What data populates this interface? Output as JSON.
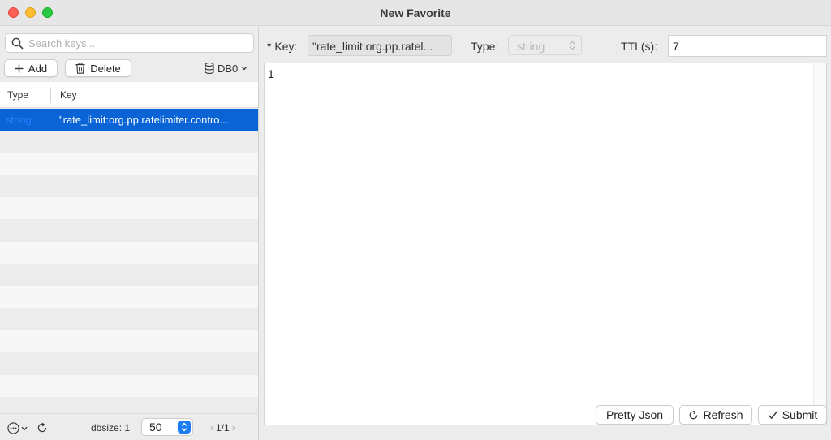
{
  "window": {
    "title": "New Favorite"
  },
  "left_panel": {
    "search": {
      "placeholder": "Search keys...",
      "value": ""
    },
    "toolbar": {
      "add_label": "Add",
      "delete_label": "Delete",
      "db_label": "DB0"
    },
    "table": {
      "columns": [
        "Type",
        "Key"
      ],
      "rows": [
        {
          "type": "string",
          "key": "\"rate_limit:org.pp.ratelimiter.contro...",
          "selected": true
        }
      ]
    },
    "footer": {
      "dbsize": "dbsize: 1",
      "page_size": "50",
      "pagination": "1/1"
    }
  },
  "right_panel": {
    "key": {
      "label": "* Key:",
      "value": "\"rate_limit:org.pp.ratel..."
    },
    "type": {
      "label": "Type:",
      "value": "string"
    },
    "ttl": {
      "label": "TTL(s):",
      "value": "7"
    },
    "editor": {
      "content": "1"
    },
    "buttons": {
      "pretty_json": "Pretty Json",
      "refresh": "Refresh",
      "submit": "Submit"
    }
  },
  "icons": {
    "search": "search-icon",
    "add": "plus-icon",
    "delete": "trash-icon",
    "database": "database-icon",
    "more": "ellipsis-circle-icon",
    "refresh": "refresh-icon",
    "submit": "checkmark-icon"
  },
  "colors": {
    "selection": "#0a64d6",
    "type_text": "#2b7fff",
    "stepper": "#1b7cf3"
  }
}
